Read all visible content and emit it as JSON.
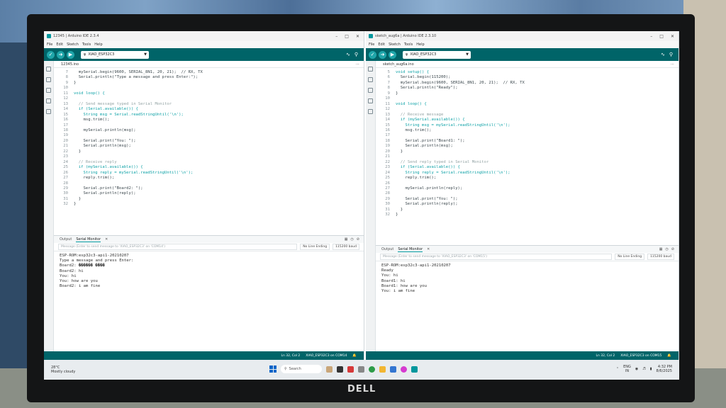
{
  "left_ide": {
    "title": "12345 | Arduino IDE 2.3.4",
    "menu": [
      "File",
      "Edit",
      "Sketch",
      "Tools",
      "Help"
    ],
    "board": "XIAO_ESP32C3",
    "file_tab": "12345.ino",
    "code_lines": [
      {
        "n": "7",
        "t": "  mySerial.begin(9600, SERIAL_8N1, 20, 21);  // RX, TX"
      },
      {
        "n": "8",
        "t": "  Serial.println(\"Type a message and press Enter:\");"
      },
      {
        "n": "9",
        "t": "}"
      },
      {
        "n": "10",
        "t": ""
      },
      {
        "n": "11",
        "t": "void loop() {"
      },
      {
        "n": "12",
        "t": ""
      },
      {
        "n": "13",
        "t": "  // Send message typed in Serial Monitor"
      },
      {
        "n": "14",
        "t": "  if (Serial.available()) {"
      },
      {
        "n": "15",
        "t": "    String msg = Serial.readStringUntil('\\n');"
      },
      {
        "n": "16",
        "t": "    msg.trim();"
      },
      {
        "n": "17",
        "t": ""
      },
      {
        "n": "18",
        "t": "    mySerial.println(msg);"
      },
      {
        "n": "19",
        "t": ""
      },
      {
        "n": "20",
        "t": "    Serial.print(\"You: \");"
      },
      {
        "n": "21",
        "t": "    Serial.println(msg);"
      },
      {
        "n": "22",
        "t": "  }"
      },
      {
        "n": "23",
        "t": ""
      },
      {
        "n": "24",
        "t": "  // Receive reply"
      },
      {
        "n": "25",
        "t": "  if (mySerial.available()) {"
      },
      {
        "n": "26",
        "t": "    String reply = mySerial.readStringUntil('\\n');"
      },
      {
        "n": "27",
        "t": "    reply.trim();"
      },
      {
        "n": "28",
        "t": ""
      },
      {
        "n": "29",
        "t": "    Serial.print(\"Board2: \");"
      },
      {
        "n": "30",
        "t": "    Serial.println(reply);"
      },
      {
        "n": "31",
        "t": "  }"
      },
      {
        "n": "32",
        "t": "}"
      }
    ],
    "panel_tabs": [
      "Output",
      "Serial Monitor"
    ],
    "send_placeholder": "Message (Enter to send message to 'XIAO_ESP32C3' on 'COM14')",
    "line_ending": "No Line Ending",
    "baud": "115200 baud",
    "monitor_lines": [
      "ESP-ROM:esp32c3-api1-20210207",
      "Type a message and press Enter:",
      "Board2: ������ ����",
      "Board2: hi",
      "You: hi",
      "You: how are you",
      "Board2: i am fine"
    ],
    "status_pos": "Ln 32, Col 2",
    "status_board": "XIAO_ESP32C3 on COM14"
  },
  "right_ide": {
    "title": "sketch_aug6a | Arduino IDE 2.3.10",
    "menu": [
      "File",
      "Edit",
      "Sketch",
      "Tools",
      "Help"
    ],
    "board": "XIAO_ESP32C3",
    "file_tab": "sketch_aug6a.ino",
    "code_lines": [
      {
        "n": "5",
        "t": "void setup() {"
      },
      {
        "n": "6",
        "t": "  Serial.begin(115200);"
      },
      {
        "n": "7",
        "t": "  mySerial.begin(9600, SERIAL_8N1, 20, 21);  // RX, TX"
      },
      {
        "n": "8",
        "t": "  Serial.println(\"Ready\");"
      },
      {
        "n": "9",
        "t": "}"
      },
      {
        "n": "10",
        "t": ""
      },
      {
        "n": "11",
        "t": "void loop() {"
      },
      {
        "n": "12",
        "t": ""
      },
      {
        "n": "13",
        "t": "  // Receive message"
      },
      {
        "n": "14",
        "t": "  if (mySerial.available()) {"
      },
      {
        "n": "15",
        "t": "    String msg = mySerial.readStringUntil('\\n');"
      },
      {
        "n": "16",
        "t": "    msg.trim();"
      },
      {
        "n": "17",
        "t": ""
      },
      {
        "n": "18",
        "t": "    Serial.print(\"Board1: \");"
      },
      {
        "n": "19",
        "t": "    Serial.println(msg);"
      },
      {
        "n": "20",
        "t": "  }"
      },
      {
        "n": "21",
        "t": ""
      },
      {
        "n": "22",
        "t": "  // Send reply typed in Serial Monitor"
      },
      {
        "n": "23",
        "t": "  if (Serial.available()) {"
      },
      {
        "n": "24",
        "t": "    String reply = Serial.readStringUntil('\\n');"
      },
      {
        "n": "25",
        "t": "    reply.trim();"
      },
      {
        "n": "26",
        "t": ""
      },
      {
        "n": "27",
        "t": "    mySerial.println(reply);"
      },
      {
        "n": "28",
        "t": ""
      },
      {
        "n": "29",
        "t": "    Serial.print(\"You: \");"
      },
      {
        "n": "30",
        "t": "    Serial.println(reply);"
      },
      {
        "n": "31",
        "t": "  }"
      },
      {
        "n": "32",
        "t": "}"
      }
    ],
    "panel_tabs": [
      "Output",
      "Serial Monitor"
    ],
    "send_placeholder": "Message (Enter to send message to 'XIAO_ESP32C3' on 'COM15')",
    "line_ending": "No Line Ending",
    "baud": "115200 baud",
    "monitor_lines": [
      "ESP-ROM:esp32c3-api1-20210207",
      "Ready",
      "You: hi",
      "Board1: hi",
      "Board1: how are you",
      "You: i am fine"
    ],
    "status_pos": "Ln 32, Col 2",
    "status_board": "XIAO_ESP32C3 on COM15"
  },
  "taskbar": {
    "weather_temp": "28°C",
    "weather_desc": "Mostly cloudy",
    "search_label": "Search",
    "lang": "ENG",
    "region": "IN",
    "time": "4:32 PM",
    "date": "8/6/2025"
  },
  "monitor_brand": "DELL",
  "colors": {
    "toolbar": "#006468",
    "accent": "#00979d"
  }
}
